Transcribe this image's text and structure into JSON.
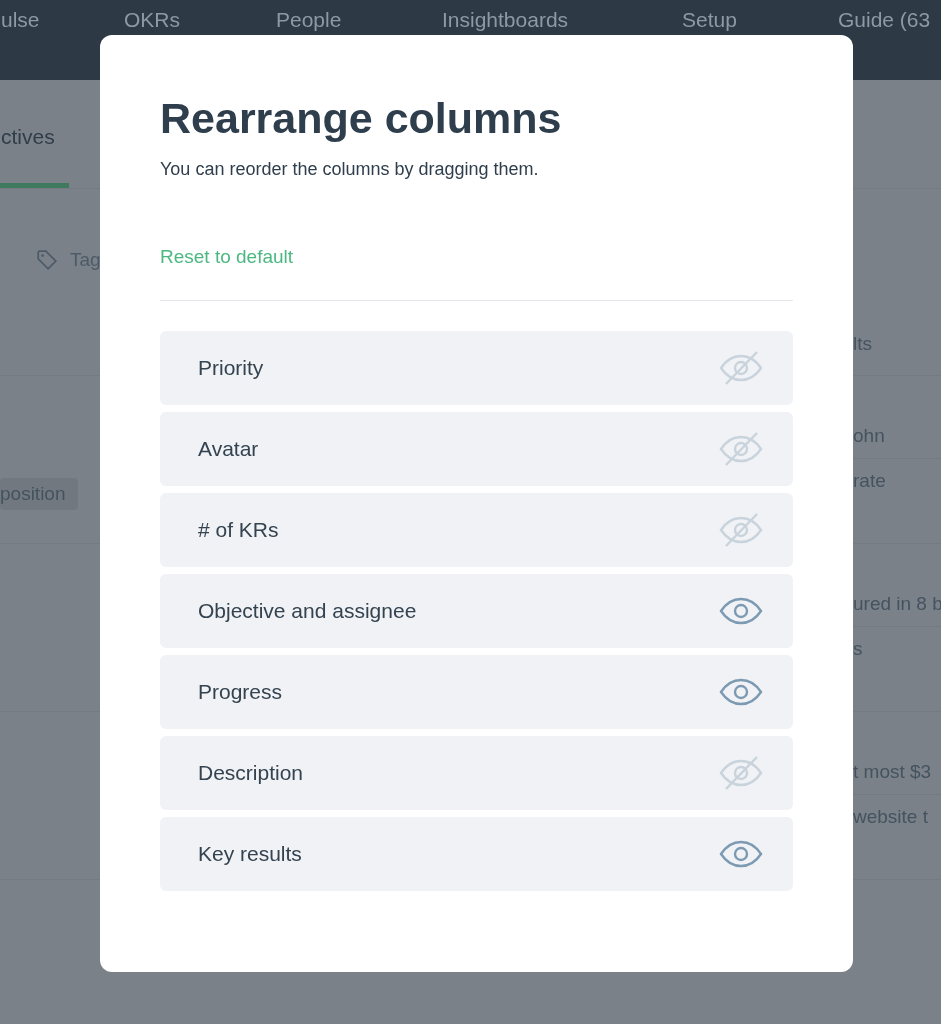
{
  "nav": [
    {
      "label": "ulse"
    },
    {
      "label": "OKRs"
    },
    {
      "label": "People"
    },
    {
      "label": "Insightboards"
    },
    {
      "label": "Setup"
    },
    {
      "label": "Guide (63"
    }
  ],
  "page_tab": {
    "label": "ctives",
    "selected": true
  },
  "filter": {
    "label": "Tag"
  },
  "tag_chip": "position",
  "right_column": {
    "header": "lts",
    "rows": [
      [
        "ohn",
        "rate"
      ],
      [
        "ured in 8 b",
        "s"
      ],
      [
        "t most $3",
        "website t"
      ]
    ]
  },
  "modal": {
    "title": "Rearrange columns",
    "subtitle": "You can reorder the columns by dragging them.",
    "reset_link": "Reset to default",
    "columns": [
      {
        "label": "Priority",
        "visible": false
      },
      {
        "label": "Avatar",
        "visible": false
      },
      {
        "label": "# of KRs",
        "visible": false
      },
      {
        "label": "Objective and assignee",
        "visible": true
      },
      {
        "label": "Progress",
        "visible": true
      },
      {
        "label": "Description",
        "visible": false
      },
      {
        "label": "Key results",
        "visible": true
      }
    ]
  }
}
